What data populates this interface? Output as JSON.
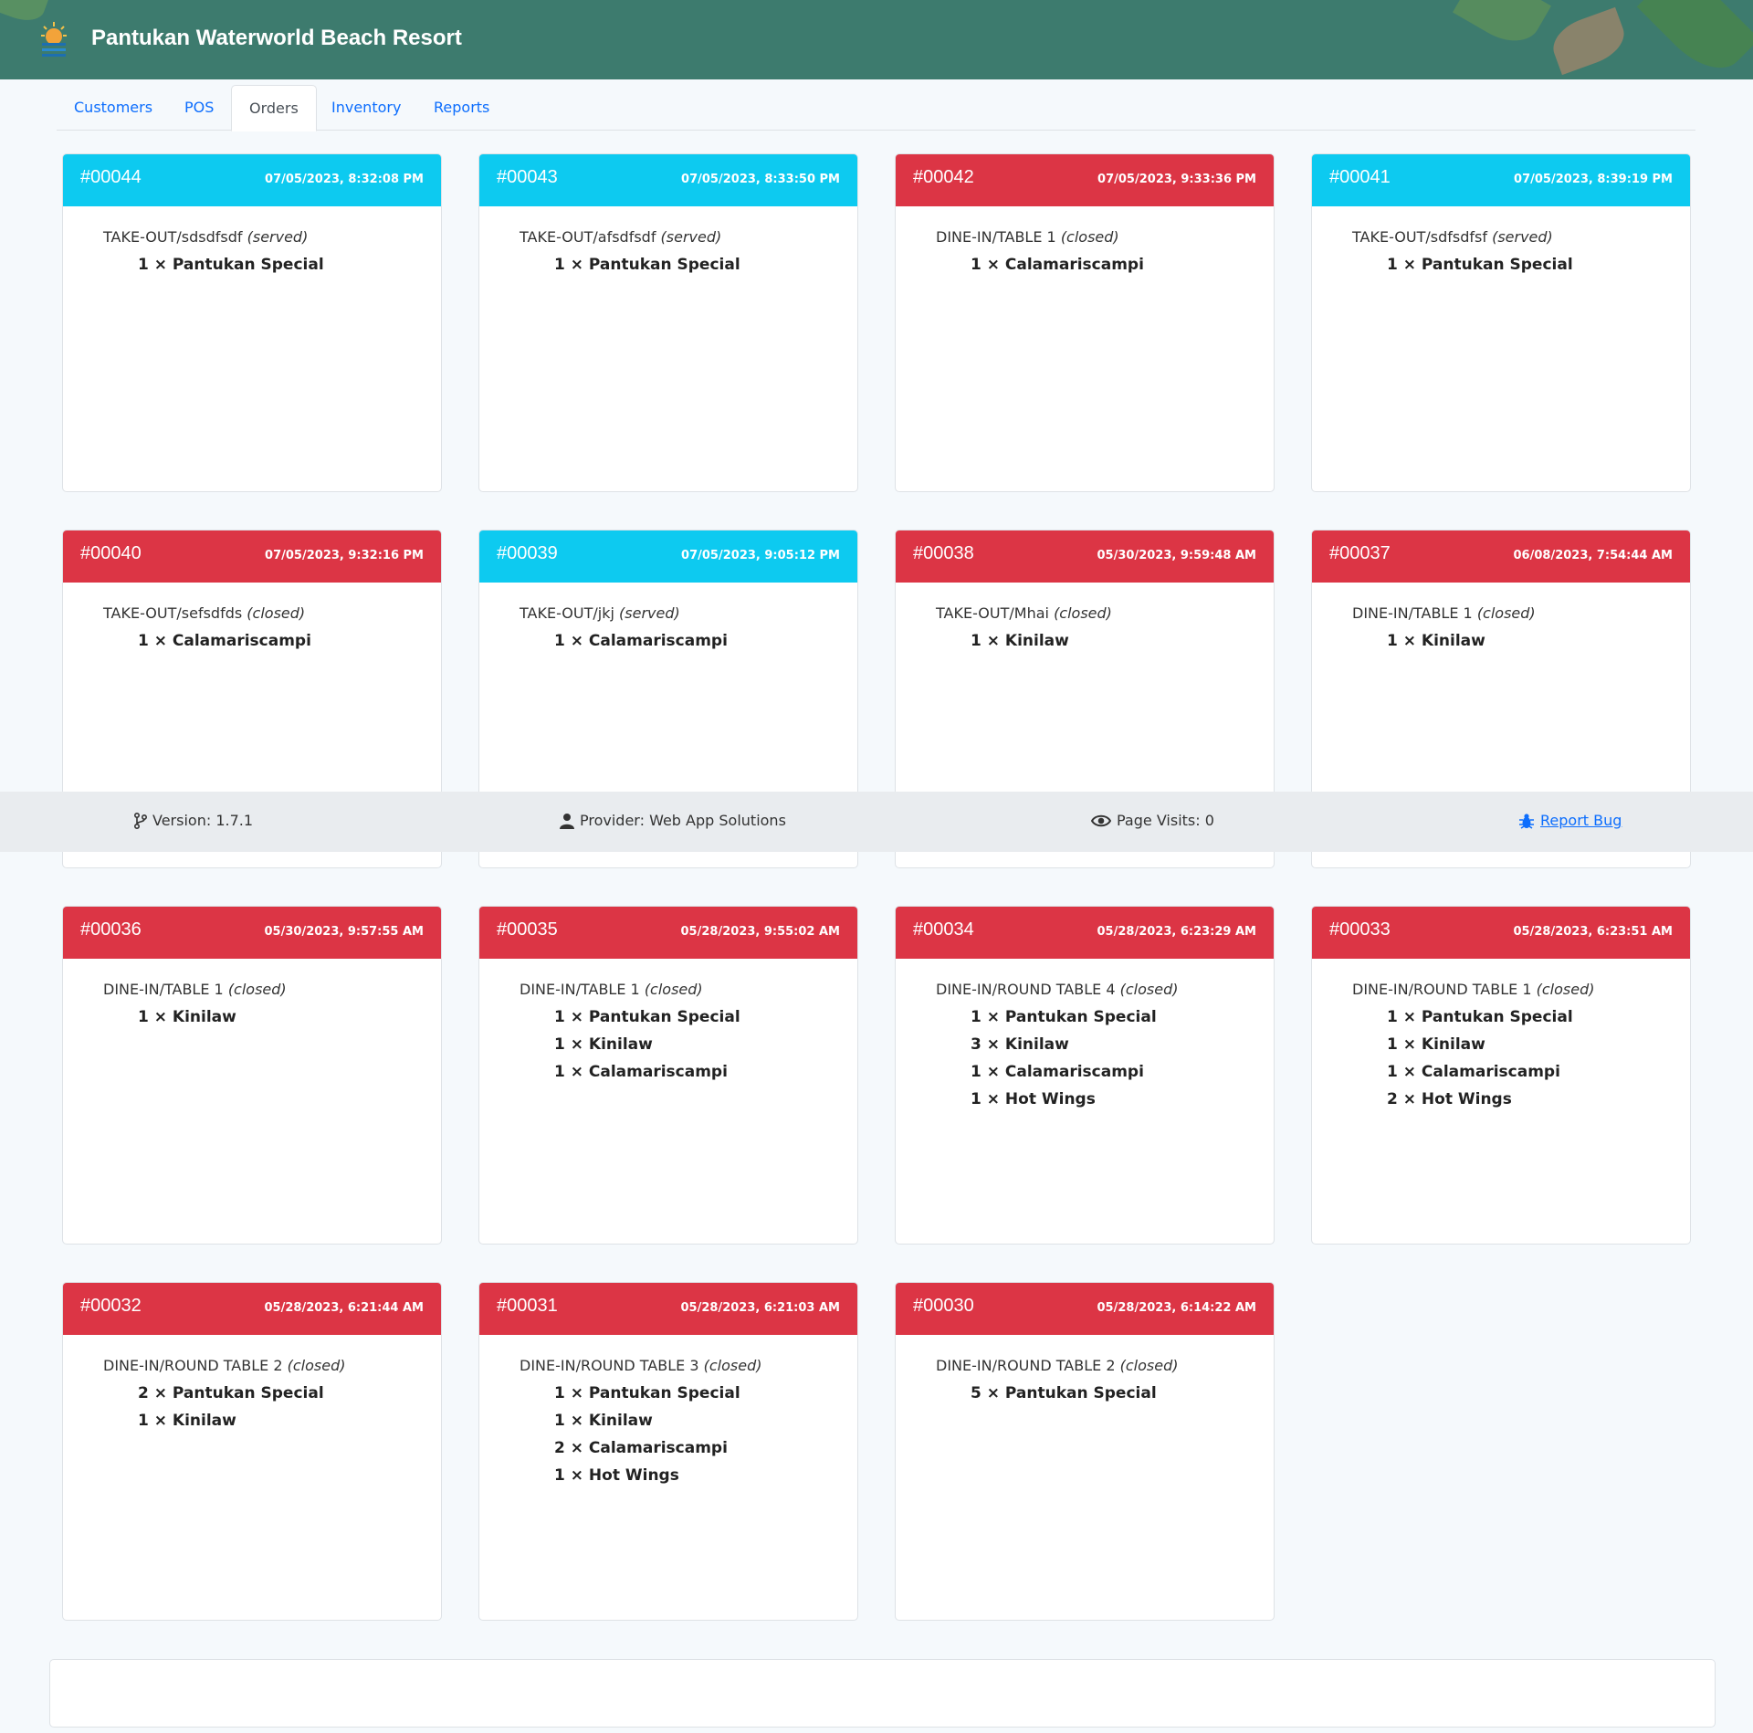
{
  "header": {
    "title": "Pantukan Waterworld Beach Resort",
    "logo_icon": "resort-logo-icon"
  },
  "tabs": [
    {
      "label": "Customers",
      "active": false
    },
    {
      "label": "POS",
      "active": false
    },
    {
      "label": "Orders",
      "active": true
    },
    {
      "label": "Inventory",
      "active": false
    },
    {
      "label": "Reports",
      "active": false
    }
  ],
  "colors": {
    "served": "#0dcaf0",
    "closed": "#dc3545",
    "header": "#3d7b6e",
    "link": "#0d6efd"
  },
  "orders": [
    {
      "number": "#00044",
      "time": "07/05/2023, 8:32:08 PM",
      "status": "served",
      "type": "TAKE-OUT/sdsdfsdf",
      "status_text": "(served)",
      "items": [
        "1 × Pantukan Special"
      ]
    },
    {
      "number": "#00043",
      "time": "07/05/2023, 8:33:50 PM",
      "status": "served",
      "type": "TAKE-OUT/afsdfsdf",
      "status_text": "(served)",
      "items": [
        "1 × Pantukan Special"
      ]
    },
    {
      "number": "#00042",
      "time": "07/05/2023, 9:33:36 PM",
      "status": "closed",
      "type": "DINE-IN/TABLE 1",
      "status_text": "(closed)",
      "items": [
        "1 × Calamariscampi"
      ]
    },
    {
      "number": "#00041",
      "time": "07/05/2023, 8:39:19 PM",
      "status": "served",
      "type": "TAKE-OUT/sdfsdfsf",
      "status_text": "(served)",
      "items": [
        "1 × Pantukan Special"
      ]
    },
    {
      "number": "#00040",
      "time": "07/05/2023, 9:32:16 PM",
      "status": "closed",
      "type": "TAKE-OUT/sefsdfds",
      "status_text": "(closed)",
      "items": [
        "1 × Calamariscampi"
      ]
    },
    {
      "number": "#00039",
      "time": "07/05/2023, 9:05:12 PM",
      "status": "served",
      "type": "TAKE-OUT/jkj",
      "status_text": "(served)",
      "items": [
        "1 × Calamariscampi"
      ]
    },
    {
      "number": "#00038",
      "time": "05/30/2023, 9:59:48 AM",
      "status": "closed",
      "type": "TAKE-OUT/Mhai",
      "status_text": "(closed)",
      "items": [
        "1 × Kinilaw"
      ]
    },
    {
      "number": "#00037",
      "time": "06/08/2023, 7:54:44 AM",
      "status": "closed",
      "type": "DINE-IN/TABLE 1",
      "status_text": "(closed)",
      "items": [
        "1 × Kinilaw"
      ]
    },
    {
      "number": "#00036",
      "time": "05/30/2023, 9:57:55 AM",
      "status": "closed",
      "type": "DINE-IN/TABLE 1",
      "status_text": "(closed)",
      "items": [
        "1 × Kinilaw"
      ]
    },
    {
      "number": "#00035",
      "time": "05/28/2023, 9:55:02 AM",
      "status": "closed",
      "type": "DINE-IN/TABLE 1",
      "status_text": "(closed)",
      "items": [
        "1 × Pantukan Special",
        "1 × Kinilaw",
        "1 × Calamariscampi"
      ]
    },
    {
      "number": "#00034",
      "time": "05/28/2023, 6:23:29 AM",
      "status": "closed",
      "type": "DINE-IN/ROUND TABLE 4",
      "status_text": "(closed)",
      "items": [
        "1 × Pantukan Special",
        "3 × Kinilaw",
        "1 × Calamariscampi",
        "1 × Hot Wings"
      ]
    },
    {
      "number": "#00033",
      "time": "05/28/2023, 6:23:51 AM",
      "status": "closed",
      "type": "DINE-IN/ROUND TABLE 1",
      "status_text": "(closed)",
      "items": [
        "1 × Pantukan Special",
        "1 × Kinilaw",
        "1 × Calamariscampi",
        "2 × Hot Wings"
      ]
    },
    {
      "number": "#00032",
      "time": "05/28/2023, 6:21:44 AM",
      "status": "closed",
      "type": "DINE-IN/ROUND TABLE 2",
      "status_text": "(closed)",
      "items": [
        "2 × Pantukan Special",
        "1 × Kinilaw"
      ]
    },
    {
      "number": "#00031",
      "time": "05/28/2023, 6:21:03 AM",
      "status": "closed",
      "type": "DINE-IN/ROUND TABLE 3",
      "status_text": "(closed)",
      "items": [
        "1 × Pantukan Special",
        "1 × Kinilaw",
        "2 × Calamariscampi",
        "1 × Hot Wings"
      ]
    },
    {
      "number": "#00030",
      "time": "05/28/2023, 6:14:22 AM",
      "status": "closed",
      "type": "DINE-IN/ROUND TABLE 2",
      "status_text": "(closed)",
      "items": [
        "5 × Pantukan Special"
      ]
    }
  ],
  "footer": {
    "version": "Version: 1.7.1",
    "provider": "Provider: Web App Solutions",
    "page_visits": "Page Visits: 0",
    "report_bug": "Report Bug"
  }
}
